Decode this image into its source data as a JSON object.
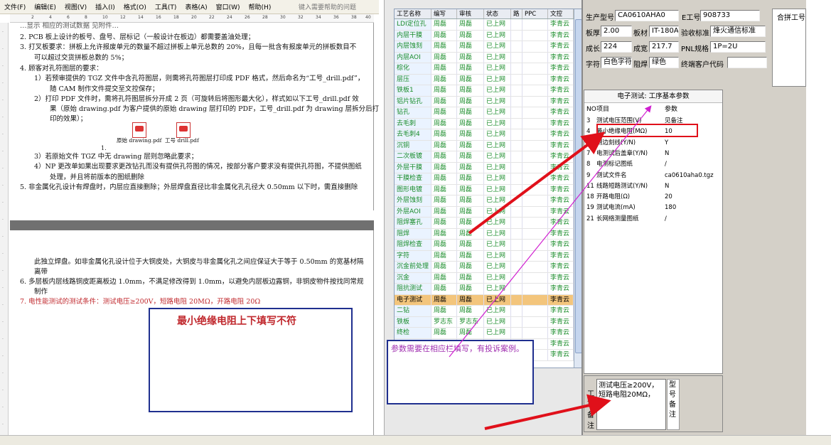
{
  "menubar": {
    "items": [
      "文件(F)",
      "编辑(E)",
      "视图(V)",
      "插入(I)",
      "格式(O)",
      "工具(T)",
      "表格(A)",
      "窗口(W)",
      "帮助(H)"
    ],
    "help_placeholder": "键入需要帮助的问题"
  },
  "ruler_ticks": [
    "2",
    "4",
    "6",
    "8",
    "10",
    "12",
    "14",
    "16",
    "18",
    "20",
    "22",
    "24",
    "26",
    "28",
    "30",
    "32",
    "34",
    "36",
    "38",
    "40"
  ],
  "doc_page1": {
    "line_top_cut": "…显示 相应的测试数据 见附件…",
    "l2": "2.    PCB 板上设计的板号、盘号、层标记（一般设计在板边）都需要盖油处理；",
    "l3a": "3.    打叉板要求：拼板上允许报废单元的数量不超过拼板上单元总数的 20%，且每一批含有报废单元的拼板数目不",
    "l3b": "可以超过交货拼板总数的 5%；",
    "l4": "4.    顾客对孔符图层的要求：",
    "l4_1a": "1）若预审提供的 TGZ 文件中含孔符图层，则需将孔符图层打印成 PDF 格式，然后命名为“工号_drill.pdf”，",
    "l4_1b": "随 CAM 制作文件提交至文控保存；",
    "l4_2a": "2）打印 PDF 文件时，需将孔符图层拆分开成 2 页（可旋转后将图形最大化），样式如以下工号_drill.pdf 效",
    "l4_2b": "果（原始 drawing.pdf 为客户提供的原始 drawing 层打印的 PDF，工号_drill.pdf 为 drawing 层拆分后打",
    "l4_2c": "印的效果）；",
    "icon_num": "1.",
    "icon1_label": "原始 drawing.pdf",
    "icon2_label": "工号  drill.pdf",
    "l4_3": "3）若原始文件 TGZ 中无 drawing 层则忽略此要求；",
    "l4_4a": "4）NP 更改单如果出现要求更改钻孔而没有提供孔符图的情况，按部分客户要求没有提供孔符图，不提供图纸",
    "l4_4b": "处理，并且将前版本的图纸删除",
    "l5": "5.    非金属化孔设计有焊盘时，内层应直接删除；外层焊盘直径比非金属化孔孔径大 0.50mm 以下时，需直接删除"
  },
  "doc_page2": {
    "p1a": "此独立焊盘。如非金属化孔设计位于大铜皮处，大铜皮与非金属化孔之间应保证大于等于 0.50mm 的宽基材隔",
    "p1b": "离带",
    "l6a": "6.    多层板内层线路铜皮距离板边 1.0mm，不满足修改得到 1.0mm，以避免内层板边露铜，非铜皮物件按找同常规",
    "l6b": "制作",
    "l7": "7.    电性能测试的测试条件：测试电压≥200V，短路电阻 20MΩ，开路电阻 20Ω"
  },
  "annotations": {
    "note_left": "最小绝缘电阻上下填写不符",
    "note_mid": "参数需要在相应栏填写，有投诉案例。"
  },
  "grid": {
    "headers": [
      "工艺名称",
      "编写",
      "审核",
      "状态",
      "路",
      "PPC",
      "文控"
    ],
    "rows": [
      [
        "LDI定位孔",
        "周磊",
        "周磊",
        "已上网",
        "",
        "",
        "李青云"
      ],
      [
        "内层干膜",
        "周磊",
        "周磊",
        "已上网",
        "",
        "",
        "李青云"
      ],
      [
        "内层蚀刻",
        "周磊",
        "周磊",
        "已上网",
        "",
        "",
        "李青云"
      ],
      [
        "内层AOI",
        "周磊",
        "周磊",
        "已上网",
        "",
        "",
        "李青云"
      ],
      [
        "棕化",
        "周磊",
        "周磊",
        "已上网",
        "",
        "",
        "李青云"
      ],
      [
        "层压",
        "周磊",
        "周磊",
        "已上网",
        "",
        "",
        "李青云"
      ],
      [
        "铁板1",
        "周磊",
        "周磊",
        "已上网",
        "",
        "",
        "李青云"
      ],
      [
        "铝片钻孔",
        "周磊",
        "周磊",
        "已上网",
        "",
        "",
        "李青云"
      ],
      [
        "钻孔",
        "周磊",
        "周磊",
        "已上网",
        "",
        "",
        "李青云"
      ],
      [
        "去毛刺",
        "周磊",
        "周磊",
        "已上网",
        "",
        "",
        "李青云"
      ],
      [
        "去毛刺4",
        "周磊",
        "周磊",
        "已上网",
        "",
        "",
        "李青云"
      ],
      [
        "沉铜",
        "周磊",
        "周磊",
        "已上网",
        "",
        "",
        "李青云"
      ],
      [
        "二次板镀",
        "周磊",
        "周磊",
        "已上网",
        "",
        "",
        "李青云"
      ],
      [
        "外层干膜",
        "周磊",
        "周磊",
        "已上网",
        "",
        "",
        "李青云"
      ],
      [
        "干膜检查",
        "周磊",
        "周磊",
        "已上网",
        "",
        "",
        "李青云"
      ],
      [
        "图形电镀",
        "周磊",
        "周磊",
        "已上网",
        "",
        "",
        "李青云"
      ],
      [
        "外层蚀刻",
        "周磊",
        "周磊",
        "已上网",
        "",
        "",
        "李青云"
      ],
      [
        "外层AOI",
        "周磊",
        "周磊",
        "已上网",
        "",
        "",
        "李青云"
      ],
      [
        "阻焊塞孔",
        "周磊",
        "周磊",
        "已上网",
        "",
        "",
        "李青云"
      ],
      [
        "阻焊",
        "周磊",
        "周磊",
        "已上网",
        "",
        "",
        "李青云"
      ],
      [
        "阻焊检查",
        "周磊",
        "周磊",
        "已上网",
        "",
        "",
        "李青云"
      ],
      [
        "字符",
        "周磊",
        "周磊",
        "已上网",
        "",
        "",
        "李青云"
      ],
      [
        "沉金前处理",
        "周磊",
        "周磊",
        "已上网",
        "",
        "",
        "李青云"
      ],
      [
        "沉金",
        "周磊",
        "周磊",
        "已上网",
        "",
        "",
        "李青云"
      ],
      [
        "阻抗测试",
        "周磊",
        "周磊",
        "已上网",
        "",
        "",
        "李青云"
      ],
      [
        "电子测试",
        "周磊",
        "周磊",
        "已上网",
        "",
        "",
        "李青云"
      ],
      [
        "二钻",
        "周磊",
        "周磊",
        "已上网",
        "",
        "",
        "李青云"
      ],
      [
        "铁板",
        "罗志东",
        "罗志东",
        "已上网",
        "",
        "",
        "李青云"
      ],
      [
        "终检",
        "周磊",
        "周磊",
        "已上网",
        "",
        "",
        "李青云"
      ],
      [
        "",
        "",
        "",
        "",
        "",
        "",
        "李青云"
      ],
      [
        "",
        "",
        "",
        "",
        "",
        "",
        "李青云"
      ]
    ],
    "highlight_index": 25
  },
  "info": {
    "model_label": "生产型号",
    "model_value": "CA0610AHA0",
    "eno_label": "E工号",
    "eno_value": "908733",
    "merge_label": "合拼工号",
    "thick_label": "板厚",
    "thick_value": "2.00",
    "mat_label": "板材",
    "mat_value": "IT-180A",
    "std_label": "验收标准",
    "std_value": "烽火通信标准",
    "len_label": "成长",
    "len_value": "224",
    "wid_label": "成宽",
    "wid_value": "217.7",
    "pnl_label": "PNL规格",
    "pnl_value": "1P=2U",
    "char_label": "字符",
    "char_value": "白色字符",
    "mask_label": "阻焊",
    "mask_value": "绿色",
    "cust_label": "终端客户代码",
    "cust_value": ""
  },
  "params": {
    "title": "电子测试: 工序基本参数",
    "head_no": "NO",
    "head_item": "项目",
    "head_val": "参数",
    "rows": [
      [
        "3",
        "测试电压范围(V)",
        "见备注"
      ],
      [
        "4",
        "最小绝缘电阻(MΩ)",
        "10"
      ],
      [
        "5",
        "测边刻线(Y/N)",
        "Y"
      ],
      [
        "7",
        "电测试后盖章(Y/N)",
        "N"
      ],
      [
        "8",
        "电测标记图纸",
        "/"
      ],
      [
        "9",
        "测试文件名",
        "ca0610aha0.tgz"
      ],
      [
        "11",
        "线路短路测试(Y/N)",
        "N"
      ],
      [
        "18",
        "开路电阻(Ω)",
        "20"
      ],
      [
        "19",
        "测试电流(mA)",
        "180"
      ],
      [
        "21",
        "长网络测量图纸",
        "/"
      ]
    ]
  },
  "remark": {
    "label": "工艺备注",
    "text": "测试电压≥200V，短路电阻20MΩ，",
    "model_label": "型号备注"
  },
  "colors": {
    "grid_text": "#1a8c2a",
    "highlight": "#f3c57c",
    "arrow_red": "#e0101a",
    "arrow_magenta": "#d020d0",
    "box_blue": "#1f2f8f"
  }
}
